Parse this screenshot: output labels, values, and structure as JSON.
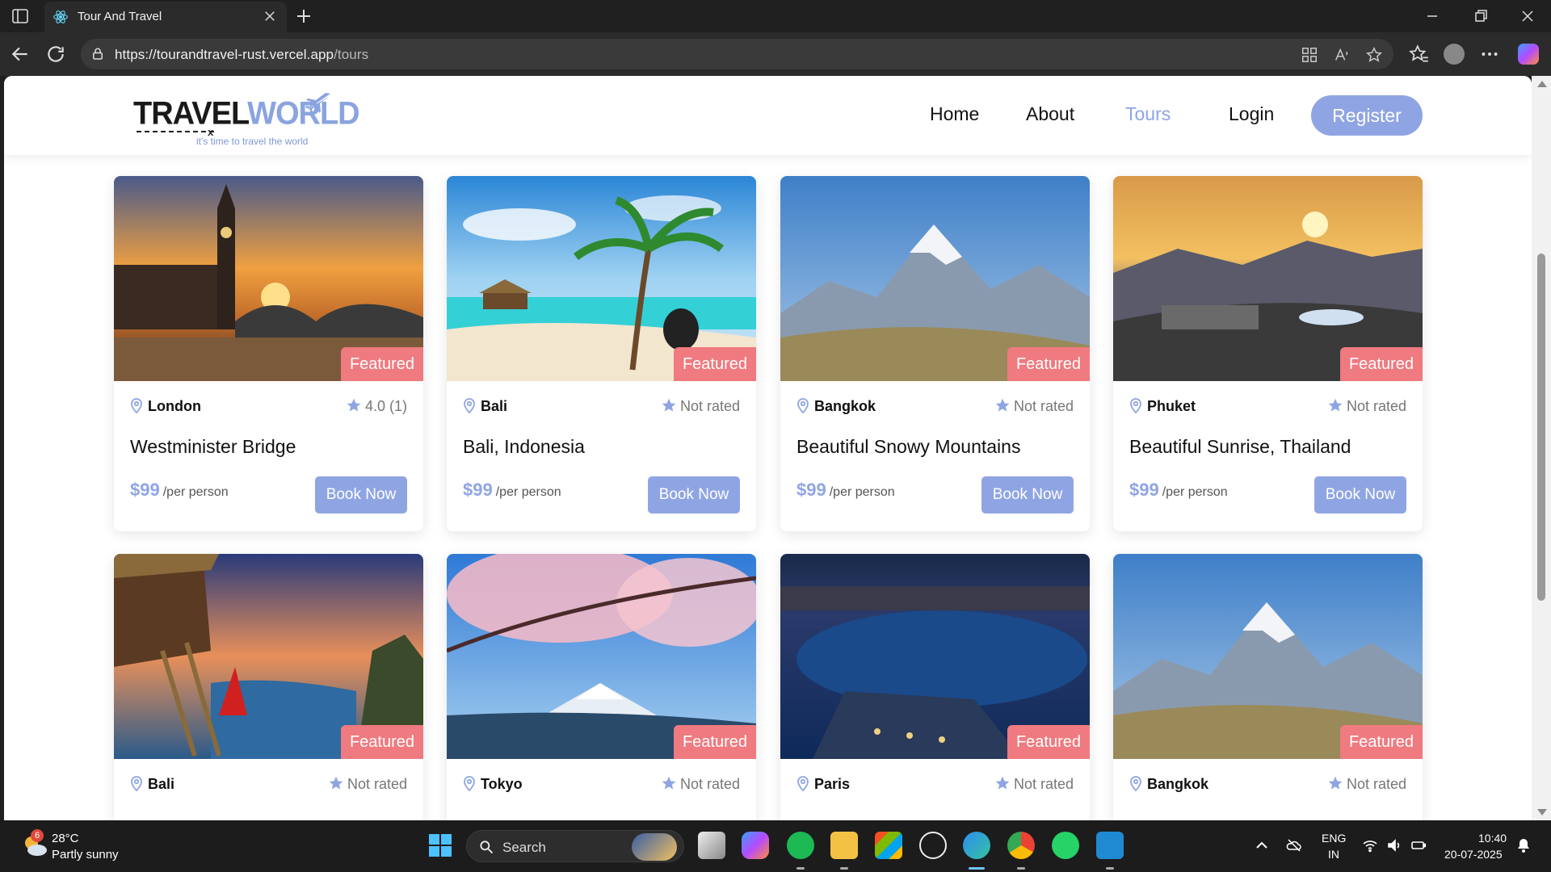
{
  "browser": {
    "tab_title": "Tour And Travel",
    "url_host": "https://tourandtravel-rust.vercel.app",
    "url_path": "/tours"
  },
  "site": {
    "logo_text_1": "TRAVEL",
    "logo_text_2": "WORLD",
    "logo_tagline": "it's time to travel the world",
    "nav": [
      "Home",
      "About",
      "Tours",
      "Login"
    ],
    "active_nav": "Tours",
    "register_label": "Register"
  },
  "labels": {
    "featured": "Featured",
    "book_now": "Book Now",
    "per_person": "/per person"
  },
  "tours": [
    {
      "city": "London",
      "rating": "4.0 (1)",
      "title": "Westminister Bridge",
      "price": "$99",
      "image": "london-sunset"
    },
    {
      "city": "Bali",
      "rating": "Not rated",
      "title": "Bali, Indonesia",
      "price": "$99",
      "image": "tropical-beach"
    },
    {
      "city": "Bangkok",
      "rating": "Not rated",
      "title": "Beautiful Snowy Mountains",
      "price": "$99",
      "image": "snowy-mountains"
    },
    {
      "city": "Phuket",
      "rating": "Not rated",
      "title": "Beautiful Sunrise, Thailand",
      "price": "$99",
      "image": "sunrise-hills"
    },
    {
      "city": "Bali",
      "rating": "Not rated",
      "title": "",
      "price": "",
      "image": "treehouse-cliff"
    },
    {
      "city": "Tokyo",
      "rating": "Not rated",
      "title": "",
      "price": "",
      "image": "cherry-blossom-fuji"
    },
    {
      "city": "Paris",
      "rating": "Not rated",
      "title": "",
      "price": "",
      "image": "night-city-lake"
    },
    {
      "city": "Bangkok",
      "rating": "Not rated",
      "title": "",
      "price": "",
      "image": "snowy-mountains"
    }
  ],
  "taskbar": {
    "weather_badge": "6",
    "temperature": "28°C",
    "condition": "Partly sunny",
    "search_label": "Search",
    "lang_1": "ENG",
    "lang_2": "IN",
    "time": "10:40",
    "date": "20-07-2025"
  },
  "colors": {
    "accent": "#8fa5e3",
    "featured": "#ef7a7f"
  }
}
